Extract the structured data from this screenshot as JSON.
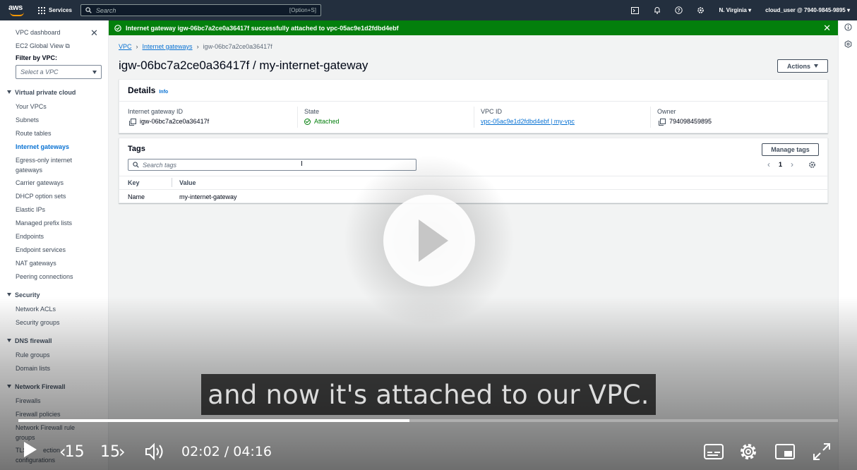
{
  "topnav": {
    "logo": "aws",
    "services": "Services",
    "search_placeholder": "Search",
    "search_shortcut": "[Option+S]",
    "region": "N. Virginia ▾",
    "account": "cloud_user @ 7940-9845-9895 ▾",
    "icons": [
      "cloudshell-icon",
      "bell-icon",
      "help-icon",
      "settings-icon"
    ]
  },
  "sidebar": {
    "dashboard": "VPC dashboard",
    "ec2_global": "EC2 Global View",
    "filter_label": "Filter by VPC:",
    "filter_placeholder": "Select a VPC",
    "sections": {
      "vpc": "Virtual private cloud",
      "security": "Security",
      "dns": "DNS firewall",
      "netfw": "Network Firewall"
    },
    "items": {
      "your_vpcs": "Your VPCs",
      "subnets": "Subnets",
      "route_tables": "Route tables",
      "internet_gateways": "Internet gateways",
      "egress_1": "Egress-only internet",
      "egress_2": "gateways",
      "carrier": "Carrier gateways",
      "dhcp": "DHCP option sets",
      "eips": "Elastic IPs",
      "prefix": "Managed prefix lists",
      "endpoints": "Endpoints",
      "endpoint_services": "Endpoint services",
      "nat": "NAT gateways",
      "peering": "Peering connections",
      "nacls": "Network ACLs",
      "sgs": "Security groups",
      "rule_groups": "Rule groups",
      "domain_lists": "Domain lists",
      "firewalls": "Firewalls",
      "firewall_policies": "Firewall policies",
      "nf_rule_1": "Network Firewall rule",
      "nf_rule_2": "groups",
      "tls_1": "TLS",
      "tls_1b": "ection",
      "tls_2": "configurations"
    }
  },
  "flash": {
    "message": "Internet gateway igw-06bc7a2ce0a36417f successfully attached to vpc-05ac9e1d2fdbd4ebf"
  },
  "breadcrumb": {
    "vpc": "VPC",
    "igws": "Internet gateways",
    "current": "igw-06bc7a2ce0a36417f"
  },
  "page": {
    "title": "igw-06bc7a2ce0a36417f / my-internet-gateway",
    "actions": "Actions"
  },
  "details": {
    "title": "Details",
    "info": "Info",
    "igw_id_label": "Internet gateway ID",
    "igw_id": "igw-06bc7a2ce0a36417f",
    "state_label": "State",
    "state": "Attached",
    "vpc_id_label": "VPC ID",
    "vpc_id": "vpc-05ac9e1d2fdbd4ebf | my-vpc",
    "owner_label": "Owner",
    "owner": "794098459895"
  },
  "tags": {
    "title": "Tags",
    "manage": "Manage tags",
    "search_placeholder": "Search tags",
    "page": "1",
    "col_key": "Key",
    "col_value": "Value",
    "rows": [
      {
        "key": "Name",
        "value": "my-internet-gateway"
      }
    ]
  },
  "video": {
    "caption": "and now it's attached to our VPC.",
    "time": "02:02 / 04:16",
    "skip_back": "15",
    "skip_forward": "15",
    "progress": 0.477
  }
}
